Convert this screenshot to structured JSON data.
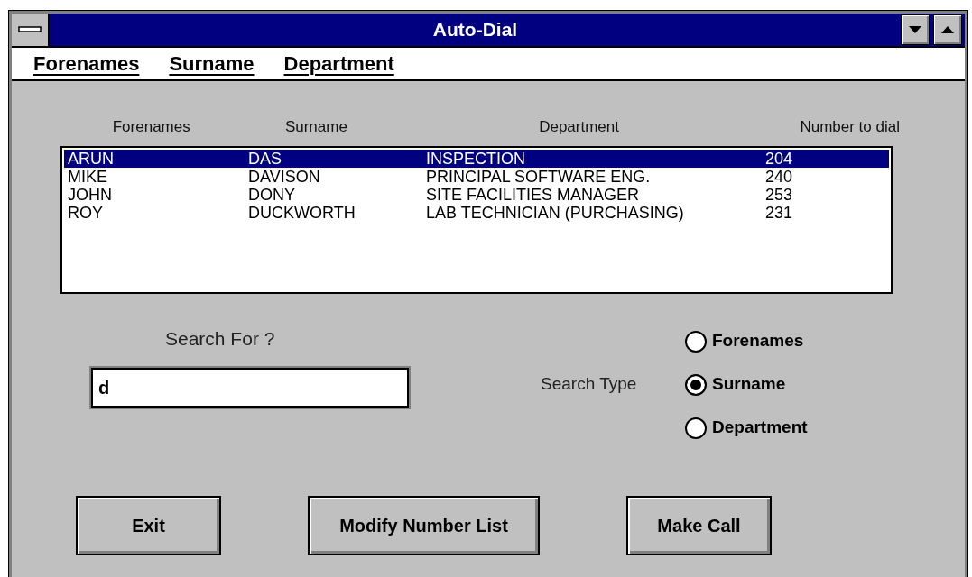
{
  "window": {
    "title": "Auto-Dial"
  },
  "menu": [
    {
      "label": "Forenames"
    },
    {
      "label": "Surname"
    },
    {
      "label": "Department"
    }
  ],
  "list": {
    "columns": [
      "Forenames",
      "Surname",
      "Department",
      "Number to dial"
    ],
    "rows": [
      {
        "cells": [
          "ARUN",
          "DAS",
          "INSPECTION",
          "204"
        ],
        "selected": true
      },
      {
        "cells": [
          "MIKE",
          "DAVISON",
          "PRINCIPAL SOFTWARE ENG.",
          "240"
        ],
        "selected": false
      },
      {
        "cells": [
          "JOHN",
          "DONY",
          "SITE FACILITIES MANAGER",
          "253"
        ],
        "selected": false
      },
      {
        "cells": [
          "ROY",
          "DUCKWORTH",
          "LAB TECHNICIAN (PURCHASING)",
          "231"
        ],
        "selected": false
      }
    ]
  },
  "search": {
    "label": "Search For ?",
    "value": "d"
  },
  "search_type": {
    "label": "Search Type",
    "options": [
      {
        "label": "Forenames",
        "selected": false
      },
      {
        "label": "Surname",
        "selected": true
      },
      {
        "label": "Department",
        "selected": false
      }
    ]
  },
  "buttons": [
    "Exit",
    "Modify Number List",
    "Make Call"
  ]
}
